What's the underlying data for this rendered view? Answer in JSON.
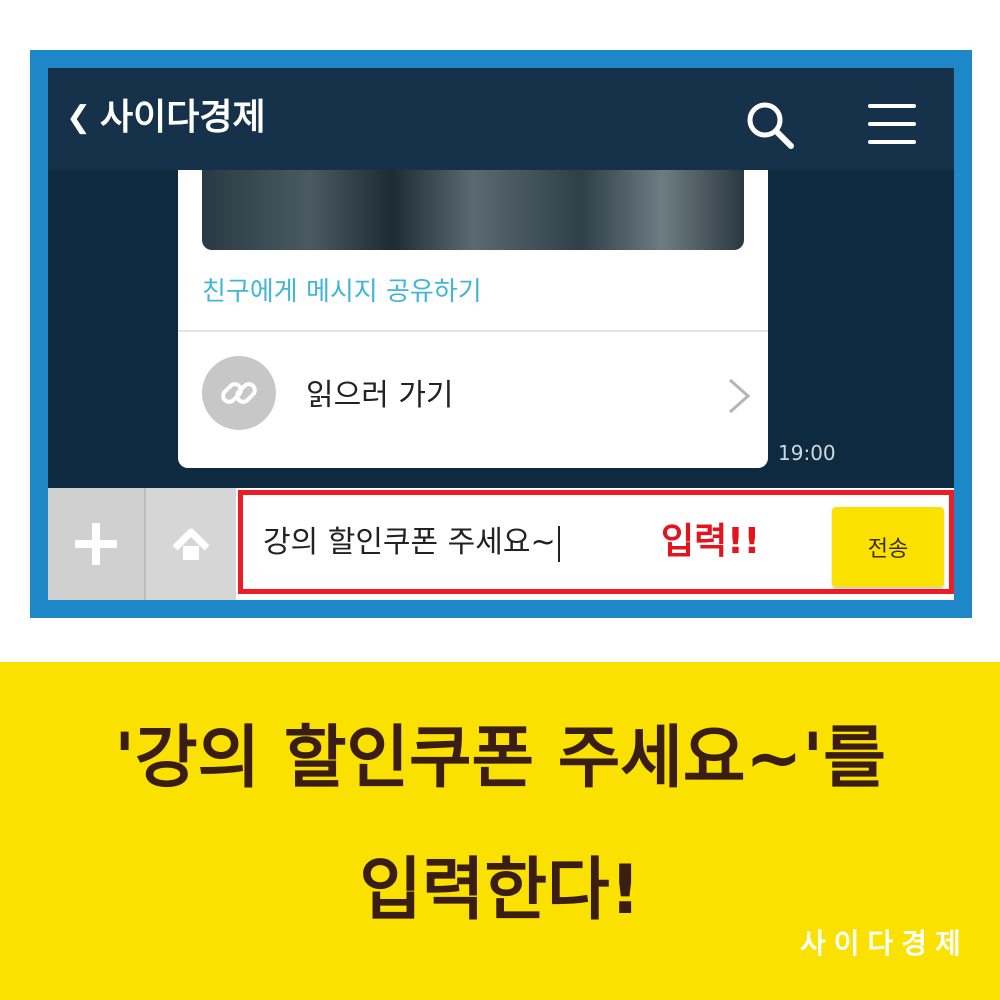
{
  "header": {
    "back_glyph": "❮",
    "title": "사이다경제",
    "search_icon": "search-icon",
    "menu_icon": "hamburger-menu-icon"
  },
  "message_card": {
    "share_link": "친구에게 메시지 공유하기",
    "read_label": "읽으러 가기",
    "link_icon": "link-icon",
    "chevron_icon": "chevron-right-icon",
    "time": "19:00"
  },
  "input_bar": {
    "plus_icon": "plus-icon",
    "home_icon": "home-icon",
    "text_value": "강의 할인쿠폰 주세요~",
    "annotation": "입력!!",
    "send_label": "전송"
  },
  "banner": {
    "line1": "'강의 할인쿠폰 주세요~'를",
    "line2": "입력한다!",
    "logo": "사이다경제"
  },
  "colors": {
    "frame_blue": "#1e87c8",
    "header_bg": "#15324a",
    "chat_bg": "#0d2a40",
    "share_cyan": "#41b6d8",
    "highlight_red": "#ee1c25",
    "kakao_yellow": "#fbe100",
    "banner_text": "#3a1d14"
  }
}
